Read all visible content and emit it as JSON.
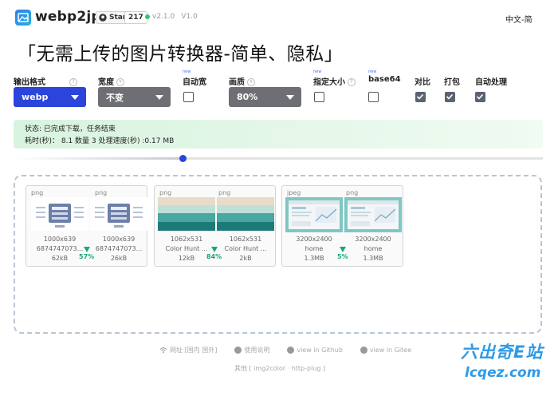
{
  "header": {
    "brand": "webp2jpg",
    "github_star_label": "Star",
    "github_star_count": "217",
    "version": "v2.1.0",
    "version_alt": "V1.0",
    "language": "中文-简"
  },
  "tagline": "「无需上传的图片转换器-简单、隐私」",
  "options": {
    "format": {
      "label": "输出格式",
      "value": "webp"
    },
    "width": {
      "label": "宽度",
      "value": "不变"
    },
    "auto_width": {
      "label": "自动宽",
      "checked": false,
      "tag": "new"
    },
    "quality": {
      "label": "画质",
      "value": "80%"
    },
    "fixed_size": {
      "label": "指定大小",
      "checked": false,
      "tag": "new"
    },
    "base64": {
      "label": "base64",
      "checked": false,
      "tag": "new"
    },
    "compare": {
      "label": "对比",
      "checked": true
    },
    "pack": {
      "label": "打包",
      "checked": true
    },
    "auto_process": {
      "label": "自动处理",
      "checked": true
    }
  },
  "status": {
    "line1": "状态: 已完成下载，任务结束",
    "line2": "耗时(秒)： 8.1 数量 3 处理速度(秒) :0.17 MB"
  },
  "progress": {
    "value": 0.32
  },
  "results": [
    {
      "original": {
        "type": "png",
        "dims": "1000x639",
        "name": "6874747073...",
        "size": "62kB"
      },
      "converted": {
        "type": "png",
        "dims": "1000x639",
        "name": "6874747073...",
        "size": "26kB"
      },
      "saving": "57%"
    },
    {
      "original": {
        "type": "png",
        "dims": "1062x531",
        "name": "Color Hunt ...",
        "size": "12kB"
      },
      "converted": {
        "type": "png",
        "dims": "1062x531",
        "name": "Color Hunt ...",
        "size": "2kB"
      },
      "saving": "84%"
    },
    {
      "original": {
        "type": "jpeg",
        "dims": "3200x2400",
        "name": "home",
        "size": "1.3MB"
      },
      "converted": {
        "type": "png",
        "dims": "3200x2400",
        "name": "home",
        "size": "1.3MB"
      },
      "saving": "5%"
    }
  ],
  "footer": {
    "website": "网址 [国内 国外]",
    "manual": "使用说明",
    "github": "view in Github",
    "gitee": "view in Gitee",
    "other": "其他 [ img2color · http-plug ]"
  },
  "watermark": {
    "line1": "六出奇E站",
    "line2": "lcqez.com"
  },
  "colors": {
    "accent": "#2b44d9",
    "select_gray": "#6d6f74",
    "success": "#18a873",
    "status_bg": "#d8f3df"
  },
  "icons": [
    "image-logo-icon",
    "github-icon",
    "help-circle-icon",
    "add-circle-icon",
    "check-icon",
    "download-arrow-icon",
    "wifi-icon",
    "help-icon",
    "github-icon",
    "gitee-icon"
  ]
}
